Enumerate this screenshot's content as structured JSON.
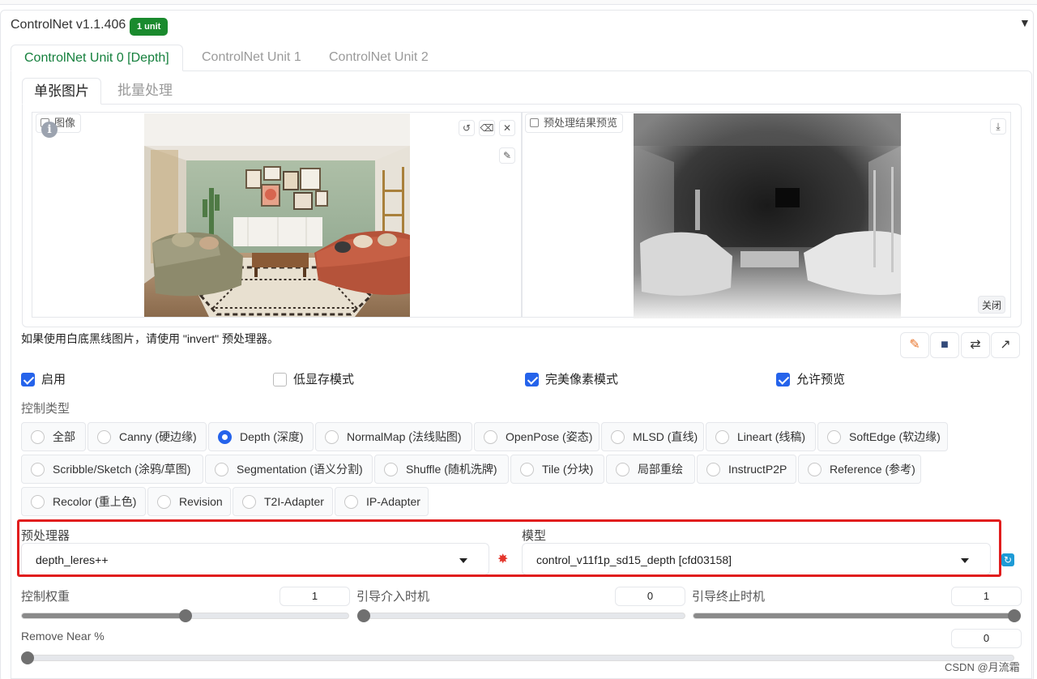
{
  "header": {
    "title": "ControlNet v1.1.406",
    "badge": "1 unit",
    "collapse_glyph": "▼"
  },
  "unit_tabs": [
    "ControlNet Unit 0 [Depth]",
    "ControlNet Unit 1",
    "ControlNet Unit 2"
  ],
  "sub_tabs": [
    "单张图片",
    "批量处理"
  ],
  "image_panel": {
    "input_label": "图像",
    "preview_label": "预处理结果预览",
    "close_label": "关闭"
  },
  "hint": "如果使用白底黑线图片，请使用 \"invert\" 预处理器。",
  "checkboxes": [
    {
      "label": "启用",
      "checked": true
    },
    {
      "label": "低显存模式",
      "checked": false
    },
    {
      "label": "完美像素模式",
      "checked": true
    },
    {
      "label": "允许预览",
      "checked": true
    }
  ],
  "control_type_label": "控制类型",
  "control_types": {
    "row1": [
      "全部",
      "Canny (硬边缘)",
      "Depth (深度)",
      "NormalMap (法线贴图)",
      "OpenPose (姿态)",
      "MLSD (直线)",
      "Lineart (线稿)",
      "SoftEdge (软边缘)"
    ],
    "row2": [
      "Scribble/Sketch (涂鸦/草图)",
      "Segmentation (语义分割)",
      "Shuffle (随机洗牌)",
      "Tile (分块)",
      "局部重绘",
      "InstructP2P",
      "Reference (参考)"
    ],
    "row3": [
      "Recolor (重上色)",
      "Revision",
      "T2I-Adapter",
      "IP-Adapter"
    ],
    "selected": "Depth (深度)"
  },
  "preprocessor": {
    "label": "预处理器",
    "value": "depth_leres++"
  },
  "model": {
    "label": "模型",
    "value": "control_v11f1p_sd15_depth [cfd03158]"
  },
  "sliders": {
    "weight": {
      "label": "控制权重",
      "value": "1",
      "fraction": 0.5
    },
    "start": {
      "label": "引导介入时机",
      "value": "0",
      "fraction": 0.0
    },
    "end": {
      "label": "引导终止时机",
      "value": "1",
      "fraction": 1.0
    },
    "remove_near": {
      "label": "Remove Near %",
      "value": "0",
      "fraction": 0.0
    }
  },
  "watermark": "CSDN @月流霜",
  "colors": {
    "accent_green": "#15803d",
    "checkbox_blue": "#2563eb",
    "highlight_red": "#e11d1d"
  }
}
